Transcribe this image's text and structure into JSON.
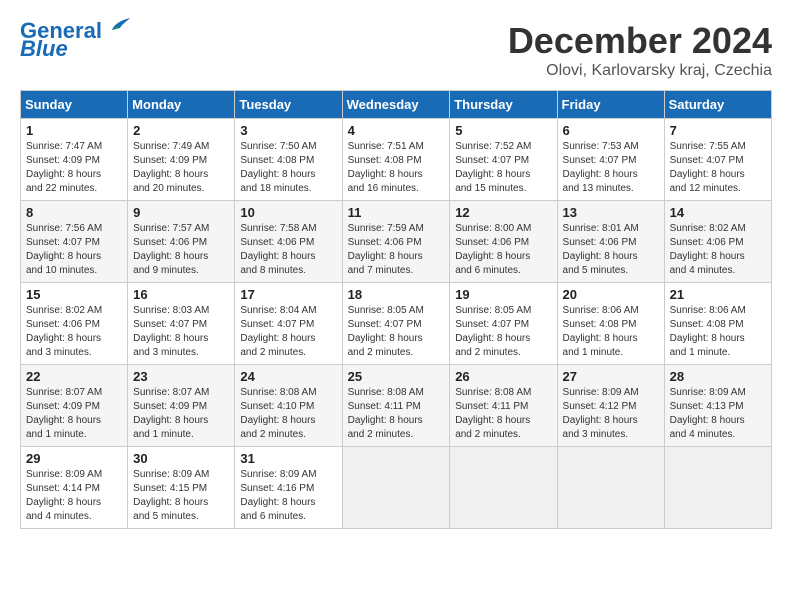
{
  "header": {
    "logo_line1": "General",
    "logo_line2": "Blue",
    "month_title": "December 2024",
    "subtitle": "Olovi, Karlovarsky kraj, Czechia"
  },
  "weekdays": [
    "Sunday",
    "Monday",
    "Tuesday",
    "Wednesday",
    "Thursday",
    "Friday",
    "Saturday"
  ],
  "weeks": [
    [
      {
        "day": 1,
        "info": "Sunrise: 7:47 AM\nSunset: 4:09 PM\nDaylight: 8 hours\nand 22 minutes."
      },
      {
        "day": 2,
        "info": "Sunrise: 7:49 AM\nSunset: 4:09 PM\nDaylight: 8 hours\nand 20 minutes."
      },
      {
        "day": 3,
        "info": "Sunrise: 7:50 AM\nSunset: 4:08 PM\nDaylight: 8 hours\nand 18 minutes."
      },
      {
        "day": 4,
        "info": "Sunrise: 7:51 AM\nSunset: 4:08 PM\nDaylight: 8 hours\nand 16 minutes."
      },
      {
        "day": 5,
        "info": "Sunrise: 7:52 AM\nSunset: 4:07 PM\nDaylight: 8 hours\nand 15 minutes."
      },
      {
        "day": 6,
        "info": "Sunrise: 7:53 AM\nSunset: 4:07 PM\nDaylight: 8 hours\nand 13 minutes."
      },
      {
        "day": 7,
        "info": "Sunrise: 7:55 AM\nSunset: 4:07 PM\nDaylight: 8 hours\nand 12 minutes."
      }
    ],
    [
      {
        "day": 8,
        "info": "Sunrise: 7:56 AM\nSunset: 4:07 PM\nDaylight: 8 hours\nand 10 minutes."
      },
      {
        "day": 9,
        "info": "Sunrise: 7:57 AM\nSunset: 4:06 PM\nDaylight: 8 hours\nand 9 minutes."
      },
      {
        "day": 10,
        "info": "Sunrise: 7:58 AM\nSunset: 4:06 PM\nDaylight: 8 hours\nand 8 minutes."
      },
      {
        "day": 11,
        "info": "Sunrise: 7:59 AM\nSunset: 4:06 PM\nDaylight: 8 hours\nand 7 minutes."
      },
      {
        "day": 12,
        "info": "Sunrise: 8:00 AM\nSunset: 4:06 PM\nDaylight: 8 hours\nand 6 minutes."
      },
      {
        "day": 13,
        "info": "Sunrise: 8:01 AM\nSunset: 4:06 PM\nDaylight: 8 hours\nand 5 minutes."
      },
      {
        "day": 14,
        "info": "Sunrise: 8:02 AM\nSunset: 4:06 PM\nDaylight: 8 hours\nand 4 minutes."
      }
    ],
    [
      {
        "day": 15,
        "info": "Sunrise: 8:02 AM\nSunset: 4:06 PM\nDaylight: 8 hours\nand 3 minutes."
      },
      {
        "day": 16,
        "info": "Sunrise: 8:03 AM\nSunset: 4:07 PM\nDaylight: 8 hours\nand 3 minutes."
      },
      {
        "day": 17,
        "info": "Sunrise: 8:04 AM\nSunset: 4:07 PM\nDaylight: 8 hours\nand 2 minutes."
      },
      {
        "day": 18,
        "info": "Sunrise: 8:05 AM\nSunset: 4:07 PM\nDaylight: 8 hours\nand 2 minutes."
      },
      {
        "day": 19,
        "info": "Sunrise: 8:05 AM\nSunset: 4:07 PM\nDaylight: 8 hours\nand 2 minutes."
      },
      {
        "day": 20,
        "info": "Sunrise: 8:06 AM\nSunset: 4:08 PM\nDaylight: 8 hours\nand 1 minute."
      },
      {
        "day": 21,
        "info": "Sunrise: 8:06 AM\nSunset: 4:08 PM\nDaylight: 8 hours\nand 1 minute."
      }
    ],
    [
      {
        "day": 22,
        "info": "Sunrise: 8:07 AM\nSunset: 4:09 PM\nDaylight: 8 hours\nand 1 minute."
      },
      {
        "day": 23,
        "info": "Sunrise: 8:07 AM\nSunset: 4:09 PM\nDaylight: 8 hours\nand 1 minute."
      },
      {
        "day": 24,
        "info": "Sunrise: 8:08 AM\nSunset: 4:10 PM\nDaylight: 8 hours\nand 2 minutes."
      },
      {
        "day": 25,
        "info": "Sunrise: 8:08 AM\nSunset: 4:11 PM\nDaylight: 8 hours\nand 2 minutes."
      },
      {
        "day": 26,
        "info": "Sunrise: 8:08 AM\nSunset: 4:11 PM\nDaylight: 8 hours\nand 2 minutes."
      },
      {
        "day": 27,
        "info": "Sunrise: 8:09 AM\nSunset: 4:12 PM\nDaylight: 8 hours\nand 3 minutes."
      },
      {
        "day": 28,
        "info": "Sunrise: 8:09 AM\nSunset: 4:13 PM\nDaylight: 8 hours\nand 4 minutes."
      }
    ],
    [
      {
        "day": 29,
        "info": "Sunrise: 8:09 AM\nSunset: 4:14 PM\nDaylight: 8 hours\nand 4 minutes."
      },
      {
        "day": 30,
        "info": "Sunrise: 8:09 AM\nSunset: 4:15 PM\nDaylight: 8 hours\nand 5 minutes."
      },
      {
        "day": 31,
        "info": "Sunrise: 8:09 AM\nSunset: 4:16 PM\nDaylight: 8 hours\nand 6 minutes."
      },
      null,
      null,
      null,
      null
    ]
  ]
}
